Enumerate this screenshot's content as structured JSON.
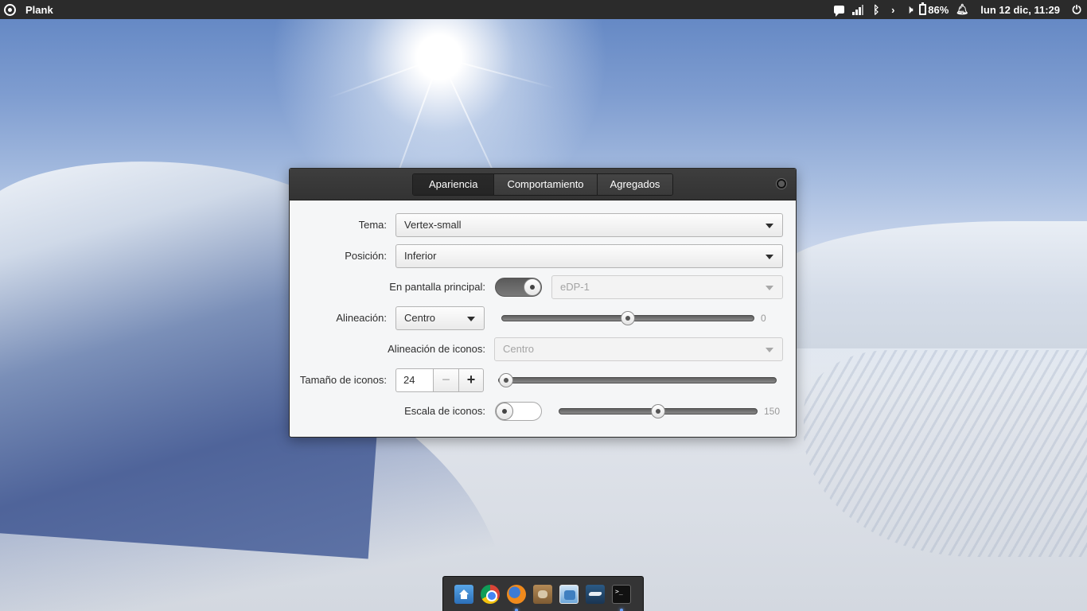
{
  "top_panel": {
    "app_name": "Plank",
    "clock": "lun 12 dic, 11:29",
    "battery": "86%",
    "icons": [
      "app-menu-icon",
      "chat-icon",
      "signal-icon",
      "bluetooth-icon",
      "chevron-right-icon",
      "volume-icon",
      "battery-icon",
      "bell-icon",
      "power-icon"
    ]
  },
  "window": {
    "tabs": [
      {
        "label": "Apariencia",
        "active": true
      },
      {
        "label": "Comportamiento",
        "active": false
      },
      {
        "label": "Agregados",
        "active": false
      }
    ],
    "rows": {
      "tema": {
        "label": "Tema:",
        "value": "Vertex-small"
      },
      "posicion": {
        "label": "Posición:",
        "value": "Inferior"
      },
      "pantalla": {
        "label": "En pantalla principal:",
        "switch_on": true,
        "value": "eDP-1"
      },
      "alineacion": {
        "label": "Alineación:",
        "value": "Centro",
        "slider_value": "0",
        "slider_fraction": 0.5
      },
      "alineacion_iconos": {
        "label": "Alineación de iconos:",
        "value": "Centro"
      },
      "tamano": {
        "label": "Tamaño de iconos:",
        "value": "24",
        "minus": "−",
        "plus": "+",
        "slider_fraction": 0.0
      },
      "escala": {
        "label": "Escala de iconos:",
        "switch_on": false,
        "slider_value": "150",
        "slider_fraction": 0.5
      }
    }
  },
  "dock": {
    "items": [
      {
        "name": "dock-files-icon",
        "running": false
      },
      {
        "name": "dock-chrome-icon",
        "running": false
      },
      {
        "name": "dock-firefox-icon",
        "running": true
      },
      {
        "name": "dock-gimp-icon",
        "running": false
      },
      {
        "name": "dock-image-viewer-icon",
        "running": false
      },
      {
        "name": "dock-steam-icon",
        "running": false
      },
      {
        "name": "dock-terminal-icon",
        "running": true
      }
    ]
  }
}
